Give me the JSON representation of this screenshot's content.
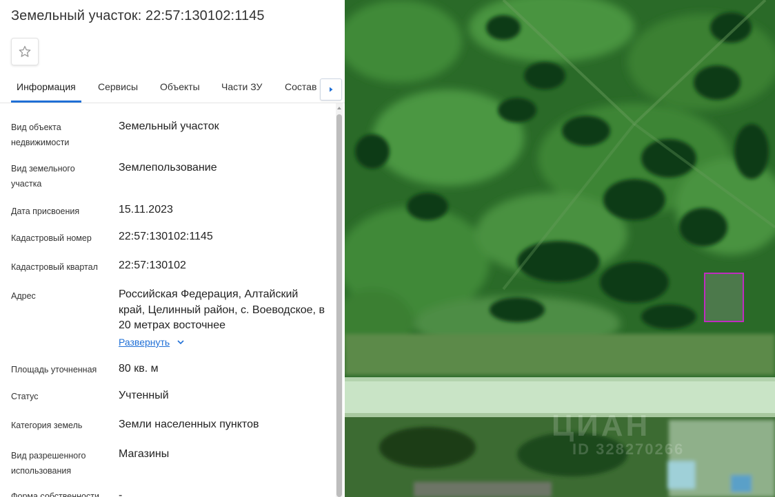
{
  "header": {
    "title": "Земельный участок: 22:57:130102:1145"
  },
  "tabs": [
    {
      "label": "Информация"
    },
    {
      "label": "Сервисы"
    },
    {
      "label": "Объекты"
    },
    {
      "label": "Части ЗУ"
    },
    {
      "label": "Состав"
    }
  ],
  "rows": [
    {
      "label": "Вид объекта недвижимости",
      "value": "Земельный участок"
    },
    {
      "label": "Вид земельного участка",
      "value": "Землепользование"
    },
    {
      "label": "Дата присвоения",
      "value": "15.11.2023"
    },
    {
      "label": "Кадастровый номер",
      "value": "22:57:130102:1145"
    },
    {
      "label": "Кадастровый квартал",
      "value": "22:57:130102"
    },
    {
      "label": "Адрес",
      "value": "Российская Федерация, Алтайский край, Целинный район, с. Воеводское, в 20 метрах восточнее"
    },
    {
      "label": "Площадь уточненная",
      "value": "80 кв. м"
    },
    {
      "label": "Статус",
      "value": "Учтенный"
    },
    {
      "label": "Категория земель",
      "value": "Земли населенных пунктов"
    },
    {
      "label": "Вид разрешенного использования",
      "value": "Магазины"
    },
    {
      "label": "Форма собственности",
      "value": "-"
    }
  ],
  "address_expand": {
    "label": "Развернуть"
  },
  "map": {
    "watermark_brand": "ЦИАН",
    "watermark_id": "ID 328270266",
    "parcel_outline_color": "#c02cc0"
  },
  "colors": {
    "accent": "#1f6fd6"
  }
}
